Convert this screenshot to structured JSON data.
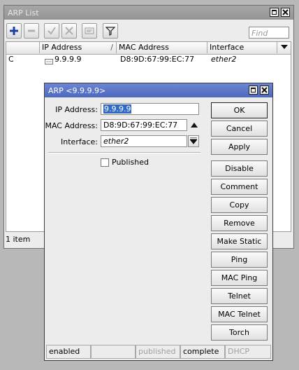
{
  "list_window": {
    "title": "ARP List",
    "find_placeholder": "Find",
    "columns": {
      "flag": "",
      "ip": "IP Address",
      "mac": "MAC Address",
      "iface": "Interface"
    },
    "rows": [
      {
        "flag": "C",
        "ip": "9.9.9.9",
        "mac": "D8:9D:67:99:EC:77",
        "iface": "ether2"
      }
    ],
    "status": "1 item"
  },
  "dialog": {
    "title": "ARP <9.9.9.9>",
    "labels": {
      "ip": "IP Address:",
      "mac": "MAC Address:",
      "iface": "Interface:"
    },
    "values": {
      "ip": "9.9.9.9",
      "mac": "D8:9D:67:99:EC:77",
      "iface": "ether2"
    },
    "published_label": "Published",
    "published_checked": false,
    "buttons": [
      "OK",
      "Cancel",
      "Apply",
      "Disable",
      "Comment",
      "Copy",
      "Remove",
      "Make Static",
      "Ping",
      "MAC Ping",
      "Telnet",
      "MAC Telnet",
      "Torch"
    ],
    "status": {
      "s1": "enabled",
      "s2": "",
      "s3": "published",
      "s4": "complete",
      "s5": "DHCP"
    }
  },
  "colors": {
    "accent": "#3169c6",
    "add_icon": "#1f3fa8",
    "title_active": "#5673c8"
  }
}
